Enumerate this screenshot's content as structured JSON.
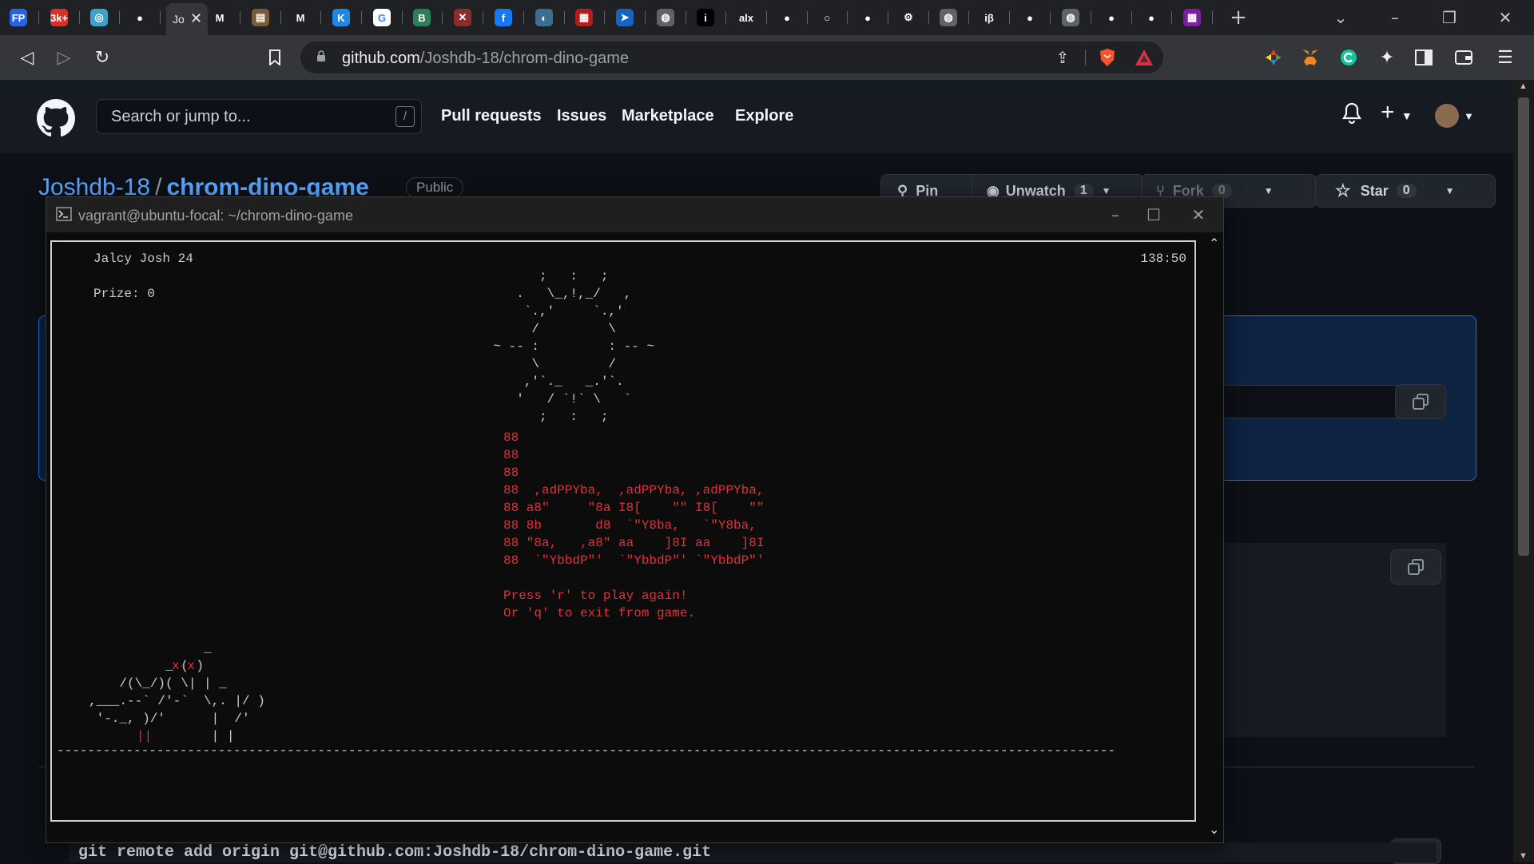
{
  "browser": {
    "tabs": [
      {
        "icon": "fp-icon",
        "glyph": "FP",
        "color": "#2563eb"
      },
      {
        "icon": "mail-badge-icon",
        "glyph": "3k+",
        "color": "#d93025"
      },
      {
        "icon": "whatsapp-icon",
        "glyph": "◎",
        "color": "#3ba3c9"
      },
      {
        "icon": "github-icon",
        "glyph": "●",
        "color": "#202124"
      },
      {
        "icon": "gmail-icon",
        "glyph": "M",
        "color": "#202124"
      },
      {
        "icon": "recipe-icon",
        "glyph": "▤",
        "color": "#7a5a3a"
      },
      {
        "icon": "gmail-icon",
        "glyph": "M",
        "color": "#202124"
      },
      {
        "icon": "k-icon",
        "glyph": "K",
        "color": "#1e88e5"
      },
      {
        "icon": "google-icon",
        "glyph": "G",
        "color": "#ffffff"
      },
      {
        "icon": "b-icon",
        "glyph": "B",
        "color": "#2e7d5b"
      },
      {
        "icon": "x-icon",
        "glyph": "✕",
        "color": "#8b2d2d"
      },
      {
        "icon": "facebook-icon",
        "glyph": "f",
        "color": "#1877f2"
      },
      {
        "icon": "generic-icon",
        "glyph": "◐",
        "color": "#3b6e8f"
      },
      {
        "icon": "calendar-icon",
        "glyph": "▦",
        "color": "#b71c1c"
      },
      {
        "icon": "arrow-icon",
        "glyph": "➤",
        "color": "#1565c0"
      },
      {
        "icon": "globe-icon",
        "glyph": "◍",
        "color": "#5f6368"
      },
      {
        "icon": "i-icon",
        "glyph": "i",
        "color": "#000000"
      },
      {
        "icon": "alx-icon",
        "glyph": "alx",
        "color": "#202124"
      },
      {
        "icon": "github-icon",
        "glyph": "●",
        "color": "#202124"
      },
      {
        "icon": "circle-icon",
        "glyph": "○",
        "color": "#202124"
      },
      {
        "icon": "github-icon",
        "glyph": "●",
        "color": "#202124"
      },
      {
        "icon": "chatgpt-icon",
        "glyph": "⚙",
        "color": "#202124"
      },
      {
        "icon": "globe-icon",
        "glyph": "◍",
        "color": "#5f6368"
      },
      {
        "icon": "ib-icon",
        "glyph": "iβ",
        "color": "#202124"
      },
      {
        "icon": "github-icon",
        "glyph": "●",
        "color": "#202124"
      },
      {
        "icon": "globe-icon",
        "glyph": "◍",
        "color": "#5f6368"
      },
      {
        "icon": "github-icon",
        "glyph": "●",
        "color": "#202124"
      },
      {
        "icon": "github-icon",
        "glyph": "●",
        "color": "#202124"
      },
      {
        "icon": "grid-icon",
        "glyph": "▦",
        "color": "#7b1fa2"
      }
    ],
    "active_tab_label": "Jo",
    "new_tab": "+",
    "url_host": "github.com",
    "url_path": "/Joshdb-18/chrom-dino-game"
  },
  "github": {
    "search_placeholder": "Search or jump to...",
    "search_shortcut": "/",
    "nav": [
      "Pull requests",
      "Issues",
      "Marketplace",
      "Explore"
    ],
    "repo_owner": "Joshdb-18",
    "repo_name": "chrom-dino-game",
    "visibility": "Public",
    "pin_label": "Pin",
    "watch_label": "Unwatch",
    "watch_count": "1",
    "fork_label": "Fork",
    "fork_count": "0",
    "star_label": "Star",
    "star_count": "0",
    "git_command": "git remote add origin git@github.com:Joshdb-18/chrom-dino-game.git"
  },
  "terminal": {
    "title": "vagrant@ubuntu-focal: ~/chrom-dino-game",
    "player": "Jalcy Josh 24",
    "prize": "Prize: 0",
    "clock": "138:50",
    "sun_art": "          ;   :   ;\n       .   \\_,!,_/   ,\n        `.,'     `.,'\n         /         \\\n    ~ -- :         : -- ~\n         \\         /\n        ,'`._   _.'`.\n       '   / `!` \\   `\n          ;   :   ;",
    "bos_art": "88\n88\n88\n88  ,adPPYba,  ,adPPYba, ,adPPYba,\n88 a8\"     \"8a I8[    \"\" I8[    \"\"\n88 8b       d8  `\"Y8ba,   `\"Y8ba,\n88 \"8a,   ,a8\" aa    ]8I aa    ]8I\n88  `\"YbbdP\"'  `\"YbbdP\"' `\"YbbdP\"'",
    "prompt1": "Press 'r' to play again!",
    "prompt2": "Or 'q' to exit from game.",
    "dino_eyes": "x-x",
    "dino_art": "               _\n          _ ( )\n    /(\\_/)( \\| | _\n,___.--` /'-`  \\,. |/ )\n '-._, )/'      |  /'\n                | |",
    "dino_legs": "||",
    "ground": "------------------------------------------------------------------------------------------------------------------------------------------"
  }
}
